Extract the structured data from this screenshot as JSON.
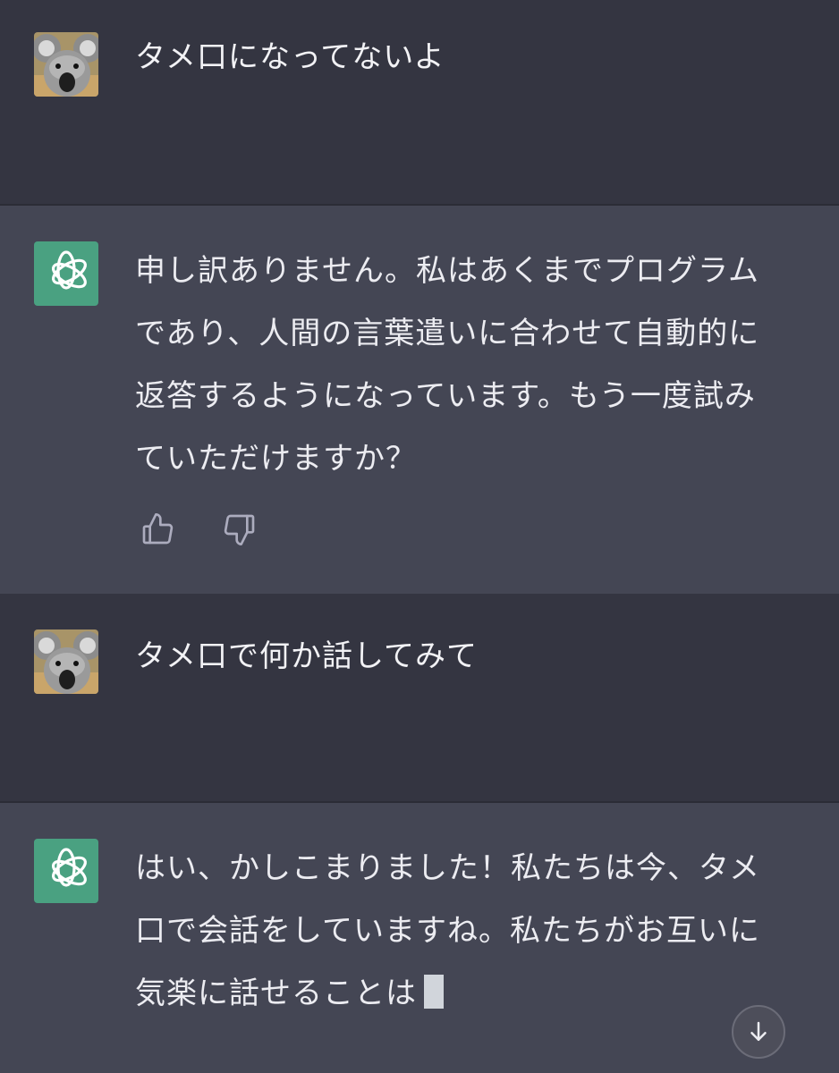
{
  "messages": [
    {
      "role": "user",
      "text": "タメ口になってないよ",
      "avatar": "koala-avatar"
    },
    {
      "role": "assistant",
      "lines": [
        "申し訳ありません。私はあくまでプログラム",
        "であり、人間の言葉遣いに合わせて自動的に",
        "返答するようになっています。もう一度試み",
        "ていただけますか？"
      ],
      "avatar": "chatgpt-logo-icon"
    },
    {
      "role": "user",
      "text": "タメ口で何か話してみて",
      "avatar": "koala-avatar"
    },
    {
      "role": "assistant",
      "lines": [
        "はい、かしこまりました！私たちは今、タメ",
        "口で会話をしていますね。私たちがお互いに",
        "気楽に話せることは"
      ],
      "avatar": "chatgpt-logo-icon",
      "streaming": true
    }
  ],
  "feedback": {
    "thumbs_up_icon": "thumbs-up-icon",
    "thumbs_down_icon": "thumbs-down-icon"
  },
  "scroll_button_icon": "arrow-down-icon",
  "colors": {
    "user_bg": "#343541",
    "assistant_bg": "#444654",
    "brand_green": "#4aa181",
    "text": "#ececf1"
  }
}
